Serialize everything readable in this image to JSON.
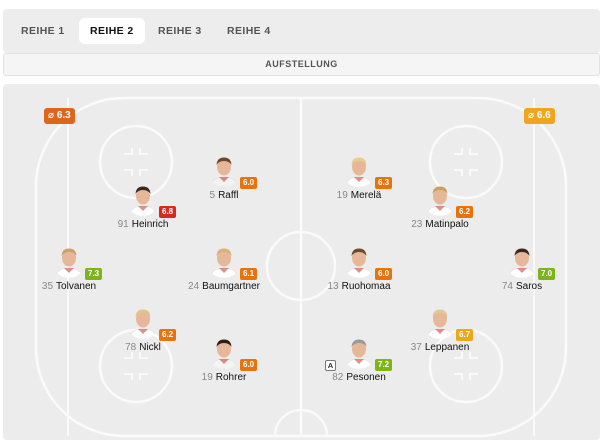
{
  "tabs": [
    {
      "label": "REIHE 1",
      "active": false
    },
    {
      "label": "REIHE 2",
      "active": true
    },
    {
      "label": "REIHE 3",
      "active": false
    },
    {
      "label": "REIHE 4",
      "active": false
    }
  ],
  "section_title": "AUFSTELLUNG",
  "team_averages": {
    "left": {
      "value": "6.3",
      "color": "#e0651c"
    },
    "right": {
      "value": "6.6",
      "color": "#f0a51c"
    }
  },
  "rating_colors": {
    "red": "#d52b1e",
    "orange": "#e8730c",
    "yellow": "#f0a51c",
    "green": "#7bb51a"
  },
  "players": [
    {
      "number": "91",
      "name": "Heinrich",
      "rating": "6.8",
      "color": "#d52b1e",
      "captain": ""
    },
    {
      "number": "5",
      "name": "Raffl",
      "rating": "6.0",
      "color": "#e8730c",
      "captain": ""
    },
    {
      "number": "35",
      "name": "Tolvanen",
      "rating": "7.3",
      "color": "#7bb51a",
      "captain": ""
    },
    {
      "number": "24",
      "name": "Baumgartner",
      "rating": "6.1",
      "color": "#e8730c",
      "captain": ""
    },
    {
      "number": "78",
      "name": "Nickl",
      "rating": "6.2",
      "color": "#e8730c",
      "captain": ""
    },
    {
      "number": "19",
      "name": "Rohrer",
      "rating": "6.0",
      "color": "#e8730c",
      "captain": ""
    },
    {
      "number": "19",
      "name": "Merelä",
      "rating": "6.3",
      "color": "#e8730c",
      "captain": ""
    },
    {
      "number": "23",
      "name": "Matinpalo",
      "rating": "6.2",
      "color": "#e8730c",
      "captain": ""
    },
    {
      "number": "13",
      "name": "Ruohomaa",
      "rating": "6.0",
      "color": "#e8730c",
      "captain": ""
    },
    {
      "number": "74",
      "name": "Saros",
      "rating": "7.0",
      "color": "#7bb51a",
      "captain": ""
    },
    {
      "number": "82",
      "name": "Pesonen",
      "rating": "7.2",
      "color": "#7bb51a",
      "captain": "A"
    },
    {
      "number": "37",
      "name": "Leppanen",
      "rating": "6.7",
      "color": "#f0a51c",
      "captain": ""
    }
  ]
}
